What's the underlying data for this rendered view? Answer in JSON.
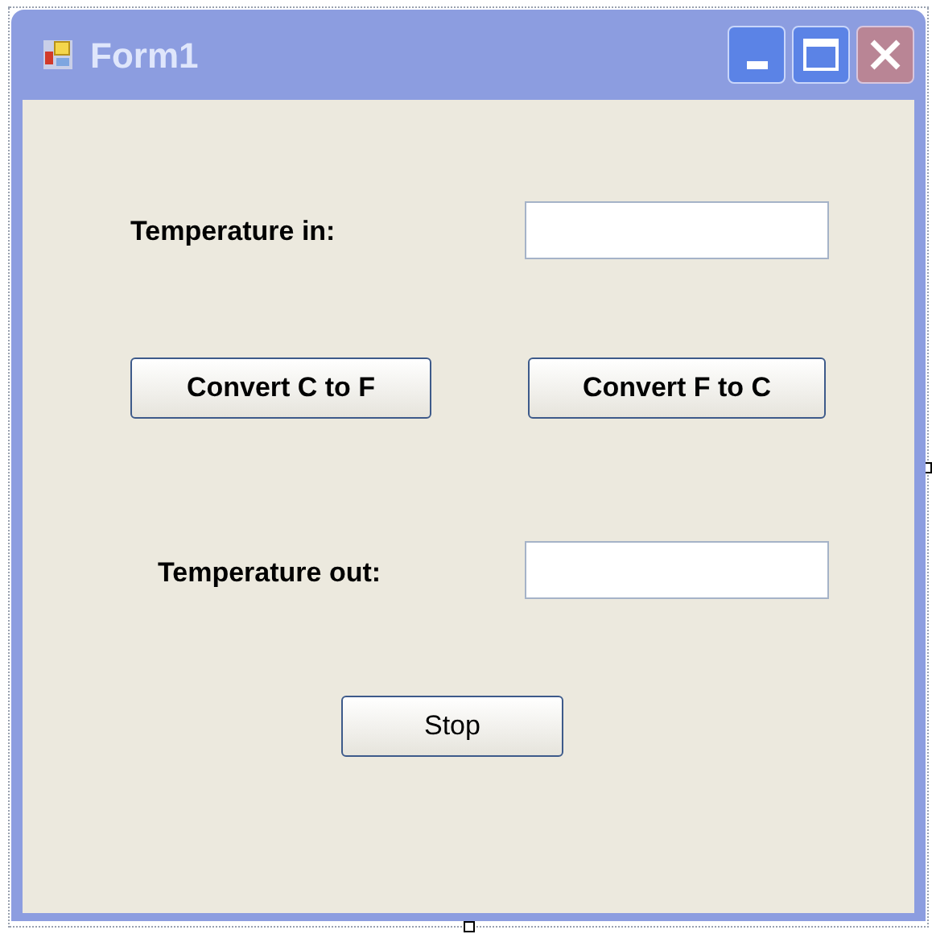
{
  "window": {
    "title": "Form1"
  },
  "labels": [
    "Temperature in:",
    "Temperature out:"
  ],
  "buttons": [
    "Convert C to F",
    "Convert F to C",
    "Stop"
  ]
}
